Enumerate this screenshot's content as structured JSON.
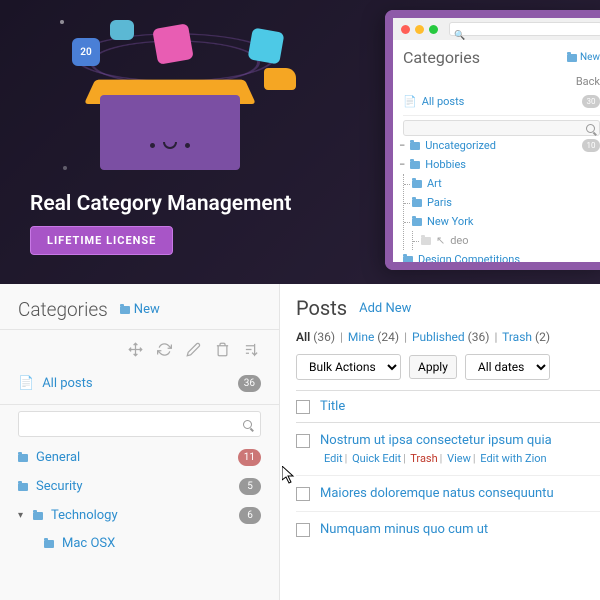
{
  "hero": {
    "title": "Real Category Management",
    "badge": "LIFETIME LICENSE",
    "chip20": "20"
  },
  "preview": {
    "title": "Categories",
    "new": "New",
    "back": "Back",
    "all": "All posts",
    "all_count": "30",
    "items": [
      {
        "label": "Uncategorized",
        "count": "10"
      },
      {
        "label": "Hobbies",
        "count": ""
      },
      {
        "label": "Art",
        "count": ""
      },
      {
        "label": "Paris",
        "count": ""
      },
      {
        "label": "New York",
        "count": ""
      },
      {
        "label": "deo",
        "count": ""
      },
      {
        "label": "Design Competitions",
        "count": ""
      }
    ]
  },
  "sidebar": {
    "title": "Categories",
    "new": "New",
    "all": "All posts",
    "all_count": "36",
    "items": [
      {
        "label": "General",
        "count": "11",
        "active": true
      },
      {
        "label": "Security",
        "count": "5"
      },
      {
        "label": "Technology",
        "count": "6",
        "expanded": true
      },
      {
        "label": "Mac OSX",
        "count": "",
        "sub": true
      }
    ]
  },
  "posts": {
    "title": "Posts",
    "add": "Add New",
    "filters": {
      "all_label": "All",
      "all_count": "(36)",
      "mine_label": "Mine",
      "mine_count": "(24)",
      "pub_label": "Published",
      "pub_count": "(36)",
      "trash_label": "Trash",
      "trash_count": "(2)"
    },
    "bulk": "Bulk Actions",
    "apply": "Apply",
    "dates": "All dates",
    "th_title": "Title",
    "rows": [
      {
        "title": "Nostrum ut ipsa consectetur ipsum quia",
        "actions": true
      },
      {
        "title": "Maiores doloremque natus consequuntu"
      },
      {
        "title": "Numquam minus quo cum ut"
      }
    ],
    "actions": {
      "edit": "Edit",
      "quick": "Quick Edit",
      "trash": "Trash",
      "view": "View",
      "zion": "Edit with Zion"
    }
  }
}
